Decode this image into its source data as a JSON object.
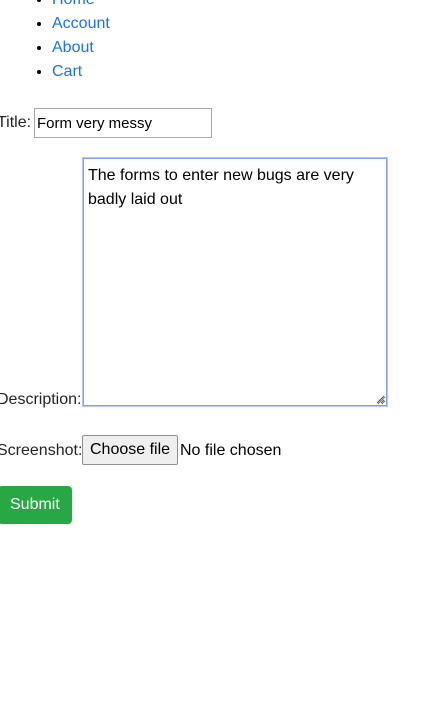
{
  "nav": {
    "items": [
      {
        "label": "Home"
      },
      {
        "label": "Account"
      },
      {
        "label": "About"
      },
      {
        "label": "Cart"
      }
    ]
  },
  "form": {
    "title_label": "Title:",
    "title_value": "Form very messy",
    "description_label": "Description:",
    "description_value": "The forms to enter new bugs are very badly laid out",
    "screenshot_label": "Screenshot:",
    "file_button_label": "Choose file",
    "file_status": "No file chosen",
    "submit_label": "Submit"
  },
  "colors": {
    "link": "#1a73e8",
    "submit_bg": "#28a745",
    "focus_border": "#7ea2f0"
  }
}
